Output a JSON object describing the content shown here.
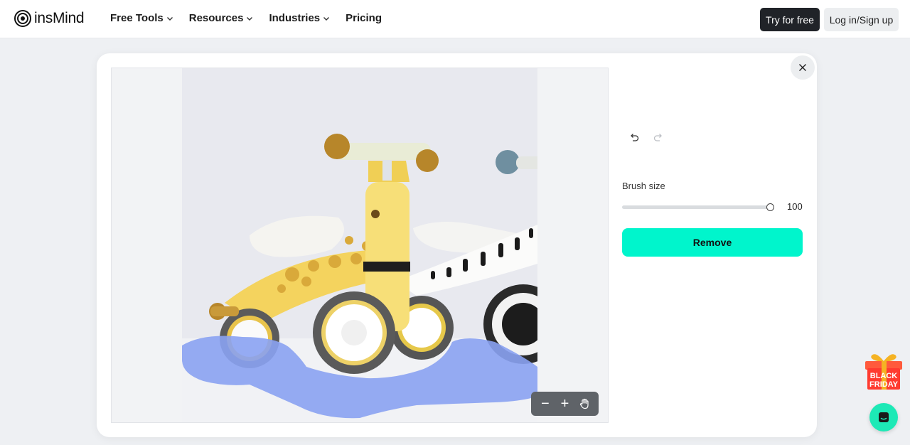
{
  "brand": {
    "name": "insMind"
  },
  "nav": {
    "items": [
      {
        "label": "Free Tools",
        "has_dropdown": true
      },
      {
        "label": "Resources",
        "has_dropdown": true
      },
      {
        "label": "Industries",
        "has_dropdown": true
      },
      {
        "label": "Pricing",
        "has_dropdown": false
      }
    ]
  },
  "header": {
    "try_label": "Try for free",
    "login_label": "Log in/Sign up"
  },
  "editor": {
    "brush_label": "Brush size",
    "brush_value": "100",
    "brush_level": 1.0,
    "remove_label": "Remove",
    "zoom_out_symbol": "−",
    "zoom_in_symbol": "+"
  },
  "promo": {
    "line1": "BLACK",
    "line2": "FRIDAY"
  },
  "colors": {
    "accent": "#00f5cc",
    "dark_button": "#202328",
    "mask": "#8aa2f2",
    "chat": "#1de9b6"
  },
  "icons": [
    "close-icon",
    "undo-icon",
    "redo-icon",
    "hand-icon",
    "chevron-down-icon",
    "chat-icon",
    "gift-icon"
  ]
}
